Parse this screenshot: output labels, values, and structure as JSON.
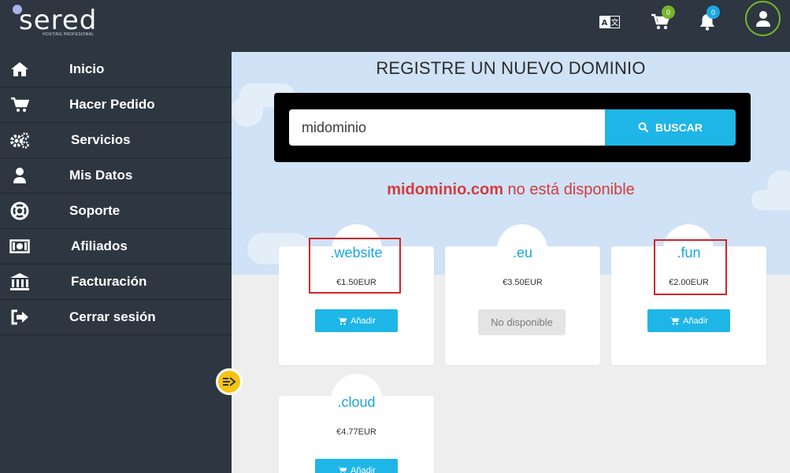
{
  "brand": {
    "name": "sered",
    "tagline": "HOSTING PROFESIONAL"
  },
  "header": {
    "cart_count": "0",
    "notifications_count": "0",
    "icons": [
      "translate-icon",
      "cart-icon",
      "bell-icon",
      "user-icon"
    ]
  },
  "sidebar": {
    "items": [
      {
        "label": "Inicio",
        "icon": "home-icon"
      },
      {
        "label": "Hacer Pedido",
        "icon": "cart-icon"
      },
      {
        "label": "Servicios",
        "icon": "gears-icon"
      },
      {
        "label": "Mis Datos",
        "icon": "user-icon"
      },
      {
        "label": "Soporte",
        "icon": "lifering-icon"
      },
      {
        "label": "Afiliados",
        "icon": "money-icon"
      },
      {
        "label": "Facturación",
        "icon": "bank-icon"
      },
      {
        "label": "Cerrar sesión",
        "icon": "logout-icon"
      }
    ]
  },
  "main": {
    "title": "REGISTRE UN NUEVO DOMINIO",
    "search": {
      "value": "midominio",
      "button_label": "BUSCAR"
    },
    "result": {
      "domain": "midominio.com",
      "message": " no está disponible"
    },
    "domains": [
      {
        "tld": ".website",
        "price": "€1.50EUR",
        "action": "Añadir",
        "available": true
      },
      {
        "tld": ".eu",
        "price": "€3.50EUR",
        "action": "No disponible",
        "available": false
      },
      {
        "tld": ".fun",
        "price": "€2.00EUR",
        "action": "Añadir",
        "available": true
      },
      {
        "tld": ".cloud",
        "price": "€4.77EUR",
        "action": "Añadir",
        "available": true
      }
    ]
  },
  "colors": {
    "sidebar": "#2d3641",
    "accent": "#1eb6e7",
    "hero": "#cfe2f6",
    "error": "#d33c3c",
    "highlight": "#d0242b"
  }
}
